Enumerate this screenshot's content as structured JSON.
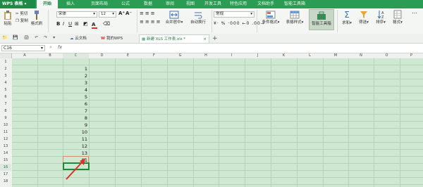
{
  "app": {
    "name": "WPS 表格"
  },
  "menu": [
    "开始",
    "插入",
    "页面布局",
    "公式",
    "数据",
    "审阅",
    "视图",
    "开发工具",
    "特色应用",
    "文档助手",
    "智能工具箱"
  ],
  "menu_active": "开始",
  "ribbon": {
    "paste": "粘贴",
    "cut": "剪切",
    "copy": "复制",
    "format_painter": "格式刷",
    "font_name": "宋体",
    "font_size": "12",
    "merge_center": "合并居中",
    "wrap_text": "自动换行",
    "number_format": "常规",
    "conditional_format": "条件格式",
    "table_style": "表格样式",
    "smart_toolbox": "智能工具箱",
    "sum": "求和",
    "filter": "筛选",
    "sort": "排序",
    "format": "格式"
  },
  "doc_tabs": [
    {
      "label": "云文档",
      "active": false
    },
    {
      "label": "我的WPS",
      "active": false
    },
    {
      "label": "新建 XLS 工作表.xls *",
      "active": true
    }
  ],
  "formula_bar": {
    "cell_ref": "C16",
    "fx": "fx",
    "content": ""
  },
  "columns": [
    "A",
    "B",
    "C",
    "D",
    "E",
    "F",
    "G",
    "H",
    "I",
    "J",
    "K",
    "L",
    "M",
    "N",
    "O",
    "P"
  ],
  "rows": [
    "1",
    "2",
    "3",
    "4",
    "5",
    "6",
    "7",
    "8",
    "9",
    "10",
    "11",
    "12",
    "13",
    "14",
    "15",
    "16",
    "17",
    "18"
  ],
  "column_c_values": [
    "",
    "1",
    "2",
    "3",
    "4",
    "5",
    "6",
    "7",
    "8",
    "9",
    "10",
    "11",
    "12",
    "13",
    "91",
    "",
    "",
    ""
  ],
  "selected_cell": "C16",
  "colors": {
    "brand": "#2a9c54",
    "grid_bg": "#cfe8d2",
    "arrow": "#d9342b"
  }
}
